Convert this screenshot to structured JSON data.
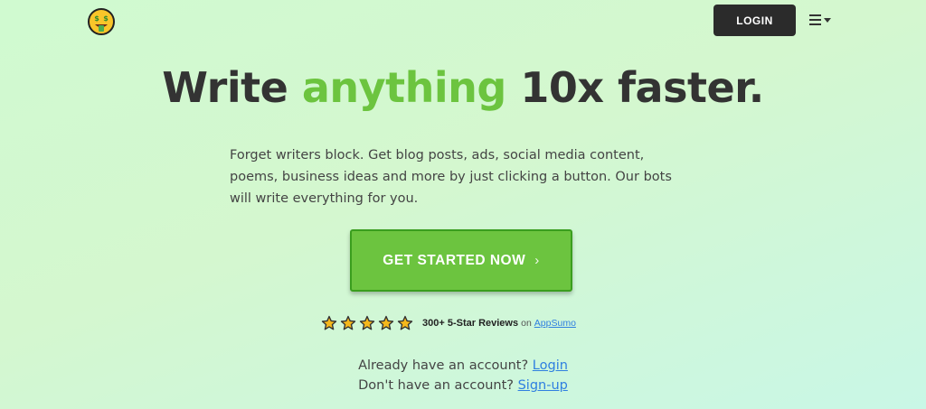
{
  "header": {
    "logo_icon": "money-mouth-face-icon",
    "login_label": "LOGIN",
    "menu_icon": "hamburger-menu-icon"
  },
  "hero": {
    "headline_before": "Write",
    "headline_accent": "anything",
    "headline_after": "10x faster.",
    "subtitle": "Forget writers block. Get blog posts, ads, social media content, poems, business ideas and more by just clicking a button. Our bots will write everything for you.",
    "cta_label": "GET STARTED NOW",
    "cta_chevron": "›"
  },
  "reviews": {
    "rating": 5,
    "count_text": "300+ 5-Star Reviews",
    "on_text": "on",
    "source_link": "AppSumo"
  },
  "account": {
    "login_prompt": "Already have an account?",
    "login_link": "Login",
    "signup_prompt": "Don't have an account?",
    "signup_link": "Sign-up"
  },
  "colors": {
    "accent": "#6cc43f",
    "button_dark": "#2b2b2b",
    "link": "#2f7fe0",
    "star": "#f5b81c"
  }
}
